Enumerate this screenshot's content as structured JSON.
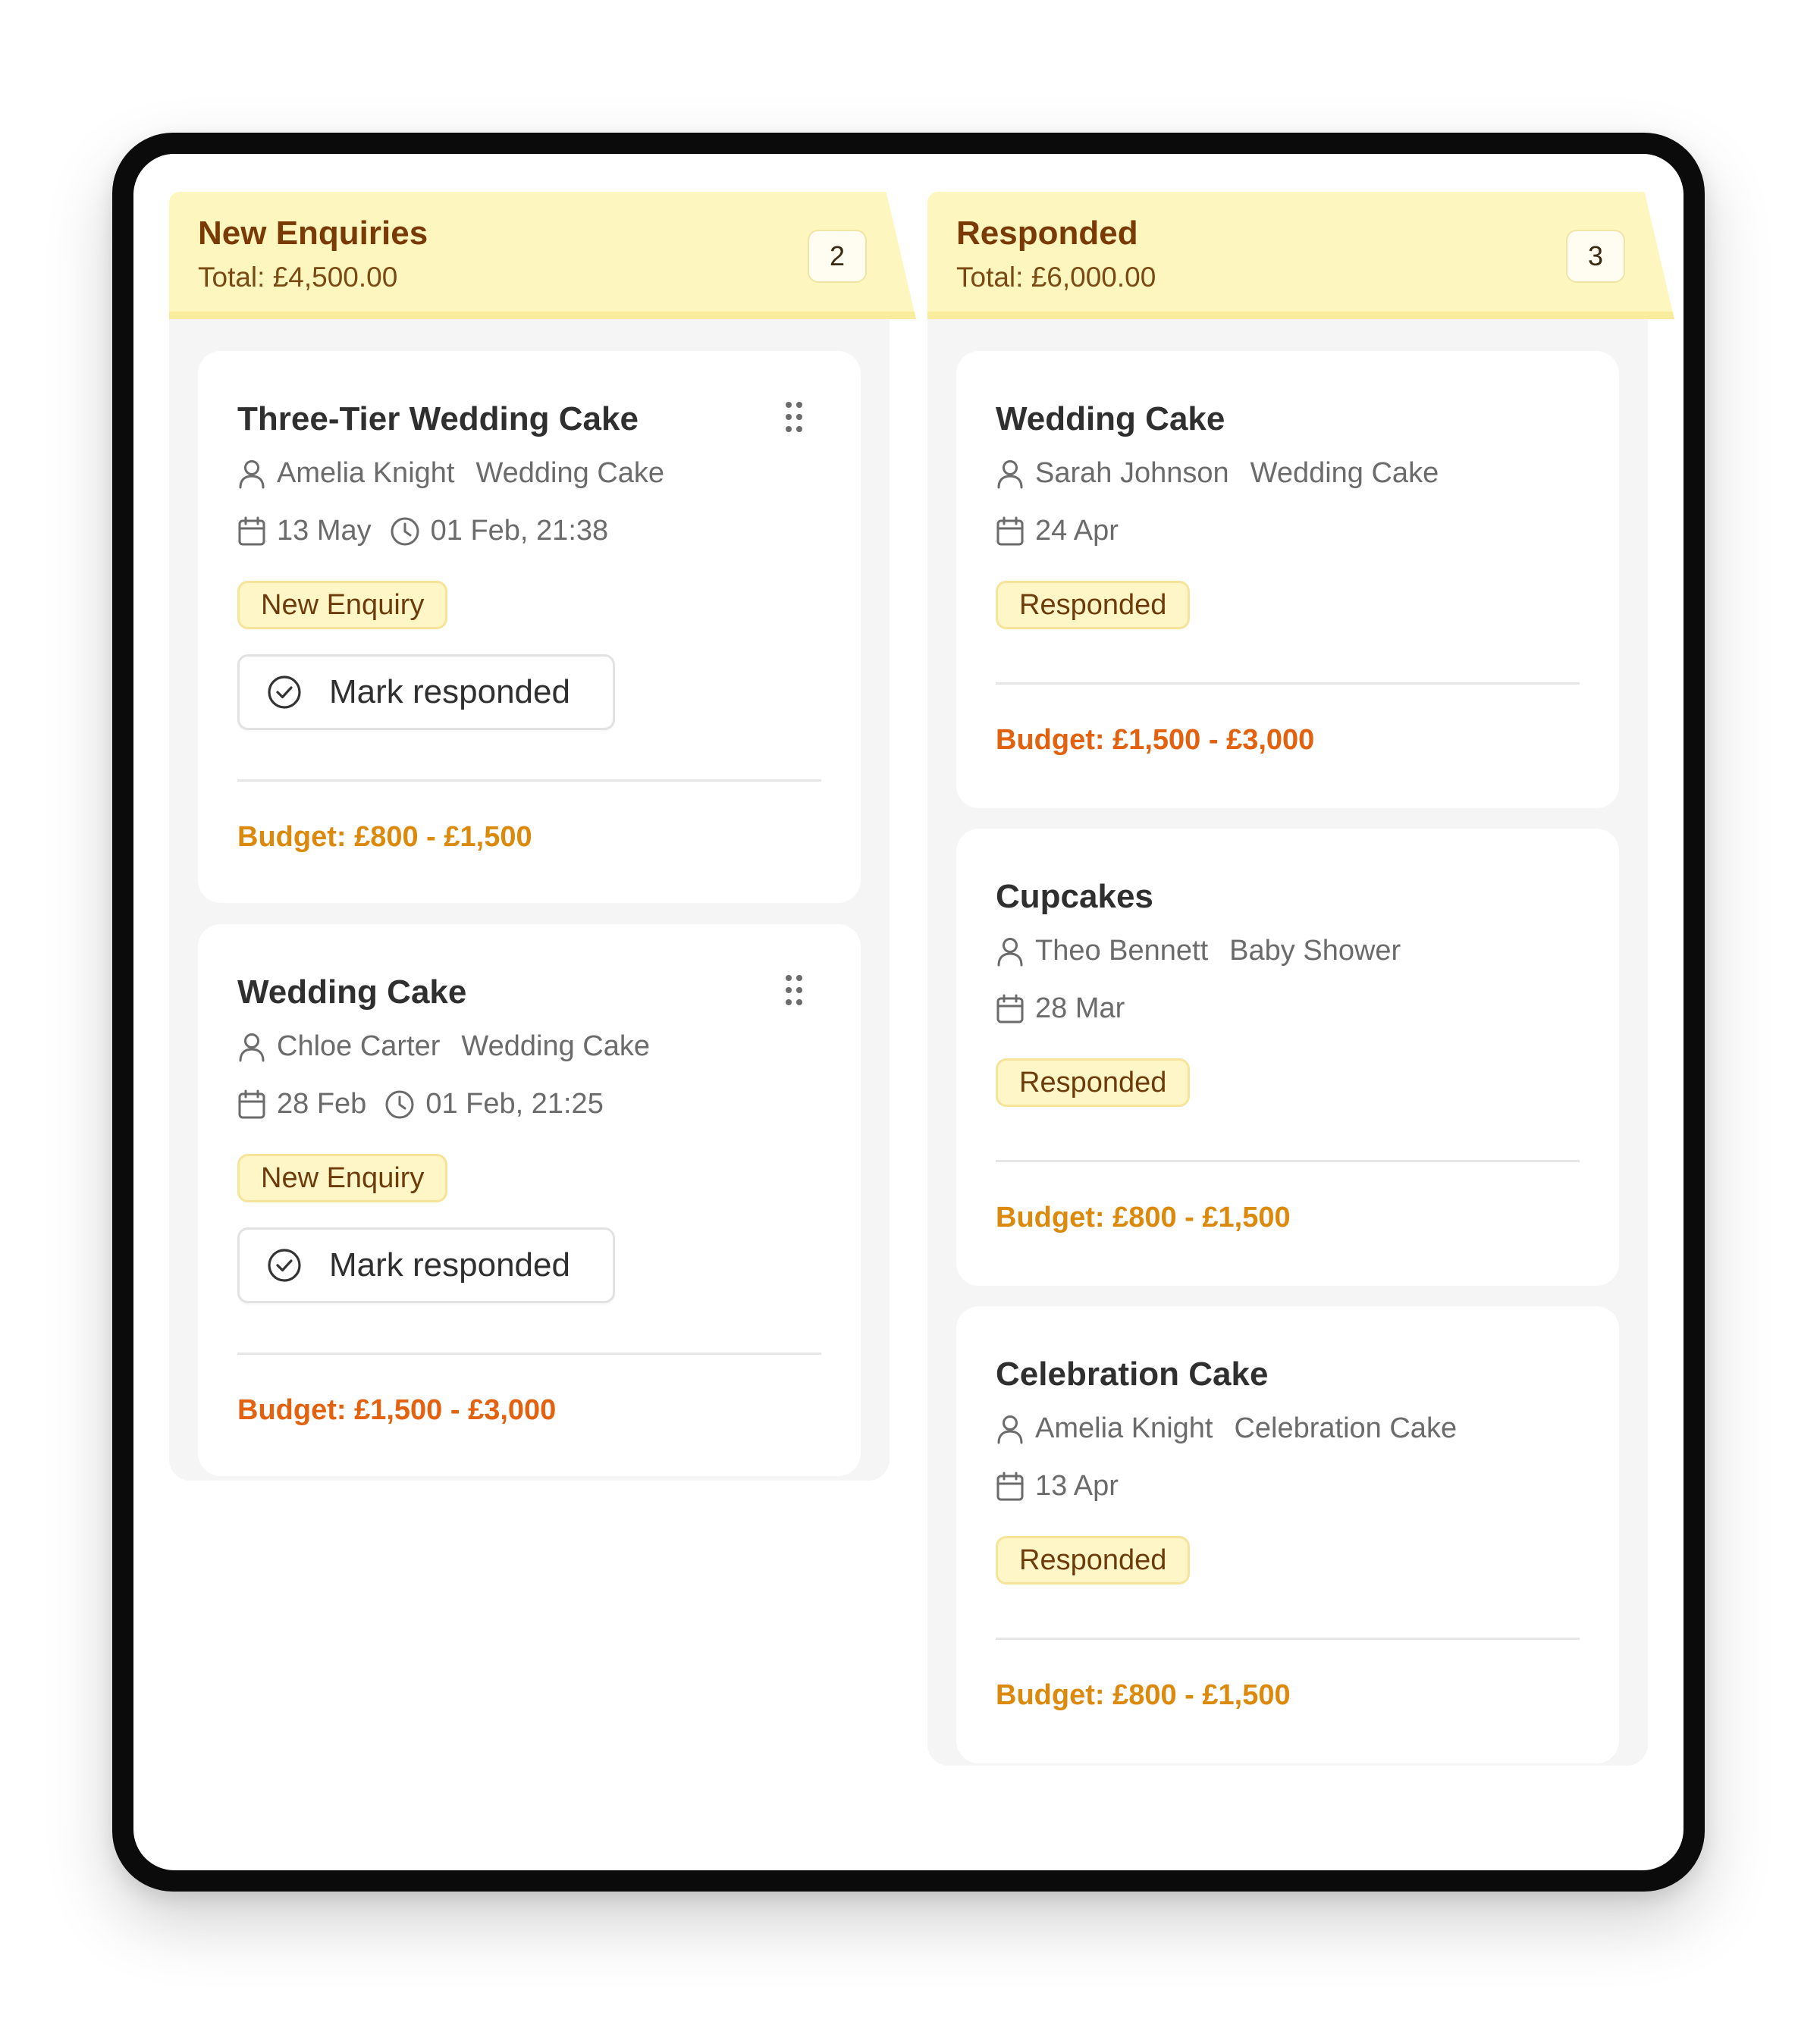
{
  "columns": {
    "new": {
      "title": "New Enquiries",
      "total": "Total: £4,500.00",
      "count": "2",
      "cards": [
        {
          "title": "Three-Tier Wedding Cake",
          "customer": "Amelia Knight",
          "event_type": "Wedding Cake",
          "event_date": "13 May",
          "received": "01 Feb, 21:38",
          "status": "New Enquiry",
          "action": "Mark responded",
          "budget": "Budget: £800 - £1,500"
        },
        {
          "title": "Wedding Cake",
          "customer": "Chloe Carter",
          "event_type": "Wedding Cake",
          "event_date": "28 Feb",
          "received": "01 Feb, 21:25",
          "status": "New Enquiry",
          "action": "Mark responded",
          "budget": "Budget: £1,500 - £3,000"
        }
      ]
    },
    "responded": {
      "title": "Responded",
      "total": "Total: £6,000.00",
      "count": "3",
      "cards": [
        {
          "title": "Wedding Cake",
          "customer": "Sarah Johnson",
          "event_type": "Wedding Cake",
          "event_date": "24 Apr",
          "status": "Responded",
          "budget": "Budget: £1,500 - £3,000"
        },
        {
          "title": "Cupcakes",
          "customer": "Theo Bennett",
          "event_type": "Baby Shower",
          "event_date": "28 Mar",
          "status": "Responded",
          "budget": "Budget: £800 - £1,500"
        },
        {
          "title": "Celebration Cake",
          "customer": "Amelia Knight",
          "event_type": "Celebration Cake",
          "event_date": "13 Apr",
          "status": "Responded",
          "budget": "Budget: £800 - £1,500"
        }
      ]
    }
  },
  "icons": {
    "customer": "user-icon",
    "event_date": "calendar-icon",
    "received": "clock-icon",
    "drag": "drag-handle-icon",
    "action": "check-circle-icon"
  },
  "colors": {
    "header_bg": "#fef6bf",
    "header_text": "#7a3a06",
    "badge_bg": "#fef6c7",
    "budget_amber": "#dc8a0e",
    "budget_orange": "#e2620f"
  }
}
